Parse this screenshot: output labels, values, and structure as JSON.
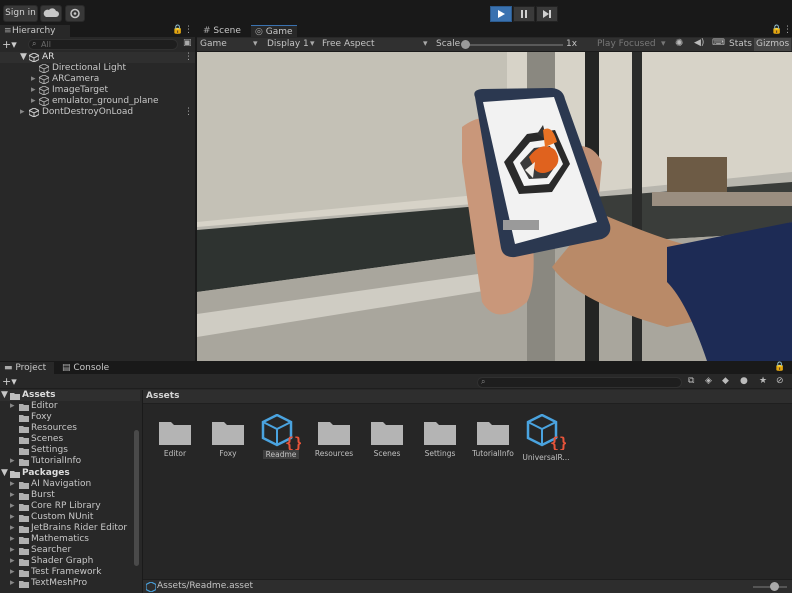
{
  "toolbar": {
    "sign_in": "Sign in",
    "cloud_icon": "cloud-icon",
    "settings_icon": "gear-icon",
    "play_icon": "play-icon",
    "pause_icon": "pause-icon",
    "step_icon": "step-icon",
    "accent": "#3a72b0"
  },
  "hierarchy": {
    "title": "Hierarchy",
    "search_placeholder": "All",
    "scene": "AR",
    "items": [
      {
        "label": "Directional Light"
      },
      {
        "label": "ARCamera"
      },
      {
        "label": "ImageTarget"
      },
      {
        "label": "emulator_ground_plane"
      }
    ],
    "ddol": "DontDestroyOnLoad"
  },
  "game": {
    "tab_scene": "Scene",
    "tab_game": "Game",
    "mode": "Game",
    "display": "Display 1",
    "aspect": "Free Aspect",
    "scale_label": "Scale",
    "scale_value": "1x",
    "play_focused": "Play Focused",
    "stats": "Stats",
    "gizmos": "Gizmos"
  },
  "project": {
    "tab_project": "Project",
    "tab_console": "Console",
    "breadcrumb": "Assets",
    "footer_path": "Assets/Readme.asset",
    "tree": {
      "assets_root": "Assets",
      "assets": [
        "Editor",
        "Foxy",
        "Resources",
        "Scenes",
        "Settings",
        "TutorialInfo"
      ],
      "packages_root": "Packages",
      "packages": [
        "AI Navigation",
        "Burst",
        "Core RP Library",
        "Custom NUnit",
        "JetBrains Rider Editor",
        "Mathematics",
        "Searcher",
        "Shader Graph",
        "Test Framework",
        "TextMeshPro"
      ]
    },
    "grid": [
      {
        "label": "Editor",
        "kind": "folder"
      },
      {
        "label": "Foxy",
        "kind": "folder"
      },
      {
        "label": "Readme",
        "kind": "asset"
      },
      {
        "label": "Resources",
        "kind": "folder"
      },
      {
        "label": "Scenes",
        "kind": "folder"
      },
      {
        "label": "Settings",
        "kind": "folder"
      },
      {
        "label": "TutorialInfo",
        "kind": "folder"
      },
      {
        "label": "UniversalR...",
        "kind": "asset"
      }
    ]
  }
}
